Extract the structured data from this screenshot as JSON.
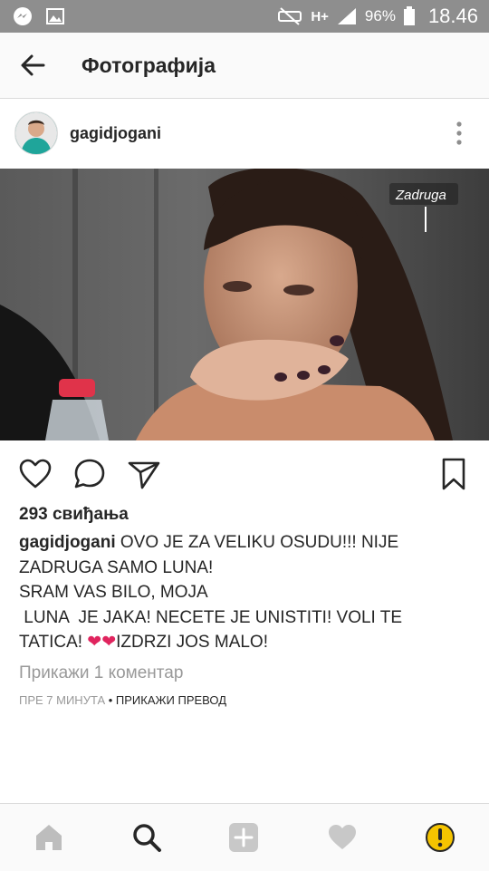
{
  "statusbar": {
    "network": "H+",
    "battery": "96%",
    "time": "18.46"
  },
  "appbar": {
    "title": "Фотографија"
  },
  "post": {
    "username": "gagidjogani",
    "photo_watermark": "Zadruga",
    "likes": "293 свиђања",
    "caption_username": "gagidjogani",
    "caption_line1": " OVO JE ZA VELIKU OSUDU!!! NIJE",
    "caption_line2": "ZADRUGA SAMO LUNA!",
    "caption_line3": "SRAM VAS BILO, MOJA",
    "caption_line4": " LUNA  JE JAKA! NECETE JE UNISTITI! VOLI TE",
    "caption_line5_a": "TATICA! ",
    "caption_hearts": "❤❤",
    "caption_line5_b": "IZDRZI JOS MALO!",
    "view_comments": "Прикажи 1 коментар",
    "time_ago": "ПРЕ 7 МИНУТА",
    "separator": " • ",
    "translate": "ПРИКАЖИ ПРЕВОД"
  },
  "colors": {
    "heart": "#e0245e",
    "alert": "#f5c400",
    "statusbar": "#8e8e8e"
  },
  "icons": [
    "back-arrow-icon",
    "more-vertical-icon",
    "heart-icon",
    "comment-icon",
    "send-icon",
    "bookmark-icon",
    "home-icon",
    "search-icon",
    "add-icon",
    "activity-heart-icon",
    "alert-icon"
  ]
}
